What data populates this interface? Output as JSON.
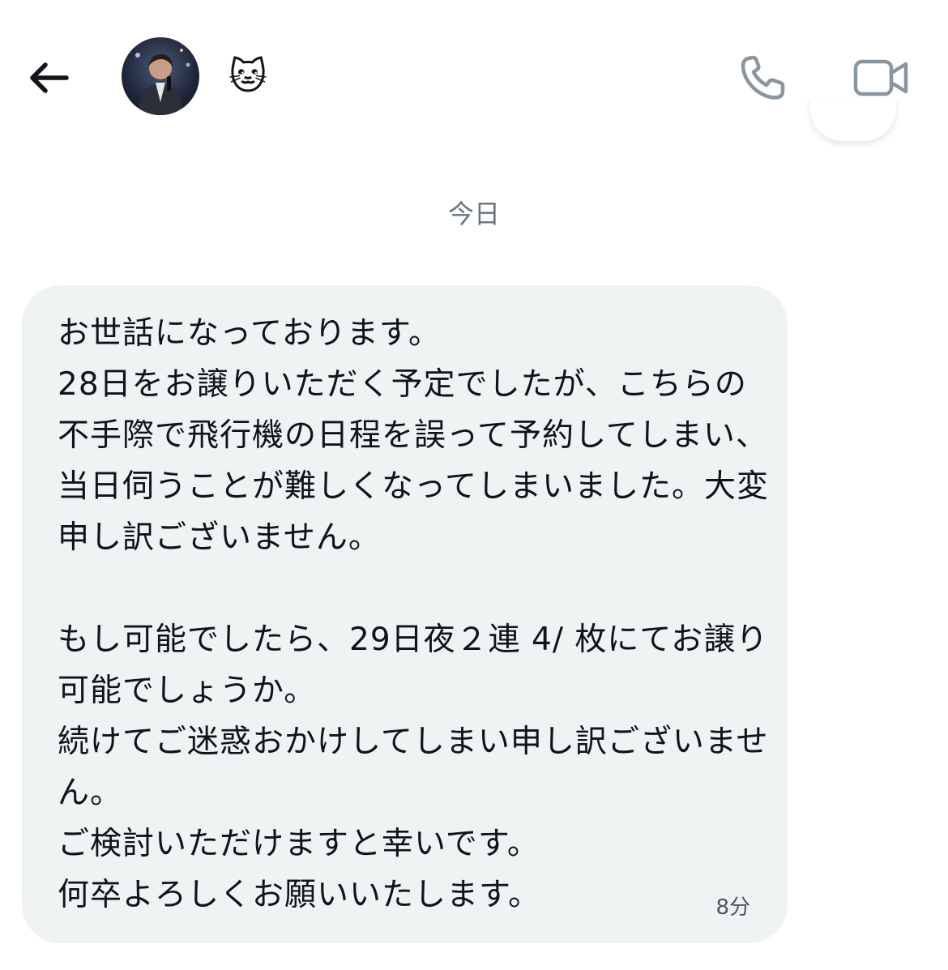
{
  "header": {
    "contact_name": "🐱",
    "back_icon": "arrow-left-icon",
    "call_icon": "phone-icon",
    "video_icon": "video-camera-icon",
    "icon_color": "#8b959e"
  },
  "conversation": {
    "date_separator": "今日",
    "messages": [
      {
        "text": "お世話になっております。\n28日をお譲りいただく予定でしたが、こちらの不手際で飛行機の日程を誤って予約してしまい、当日伺うことが難しくなってしまいました。大変申し訳ございません。\n\nもし可能でしたら、29日夜２連 4/ 枚にてお譲り可能でしょうか。\n続けてご迷惑おかけしてしまい申し訳ございません。\nご検討いただけますと幸いです。\n何卒よろしくお願いいたします。",
        "time": "8分"
      }
    ]
  },
  "colors": {
    "bubble_bg": "#eff3f4",
    "secondary_text": "#69737d"
  }
}
